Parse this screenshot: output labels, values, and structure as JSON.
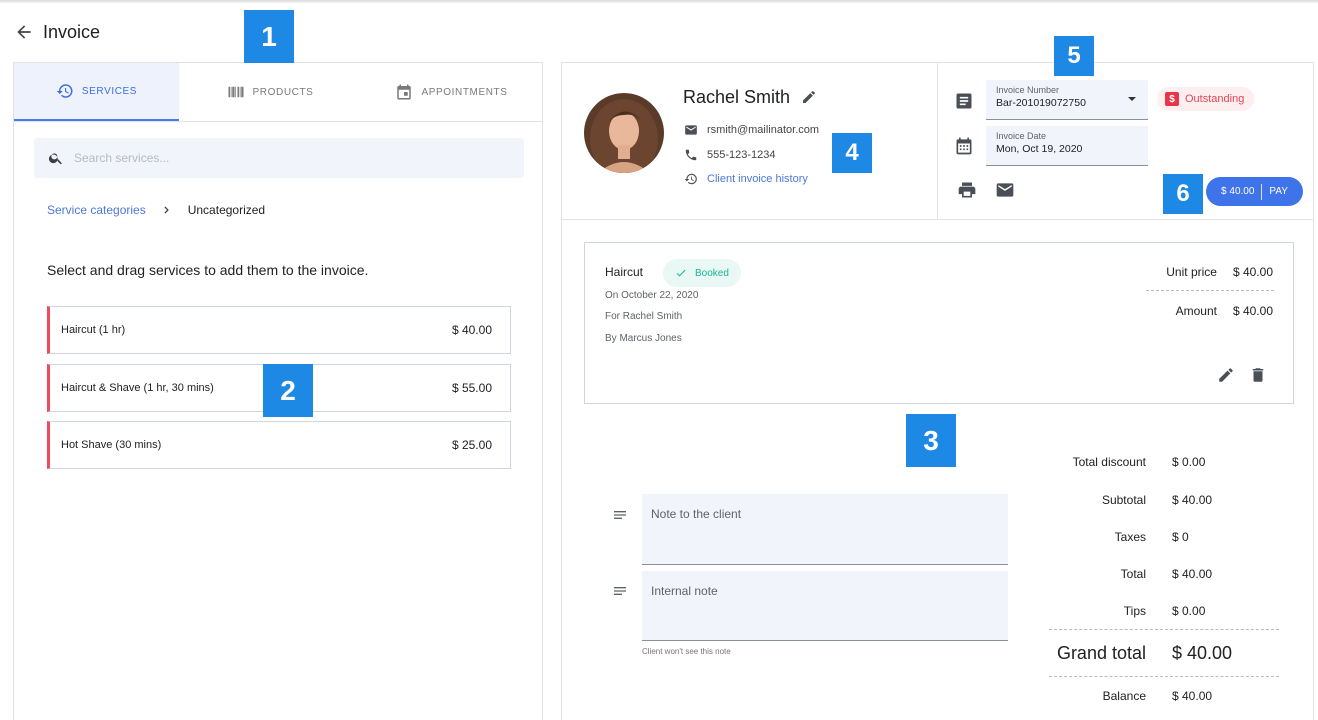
{
  "header": {
    "title": "Invoice"
  },
  "tabs": [
    {
      "label": "SERVICES"
    },
    {
      "label": "PRODUCTS"
    },
    {
      "label": "APPOINTMENTS"
    }
  ],
  "search": {
    "placeholder": "Search services..."
  },
  "breadcrumb": {
    "link": "Service categories",
    "current": "Uncategorized"
  },
  "instructions": "Select and drag services to add them to the invoice.",
  "services": [
    {
      "name": "Haircut (1 hr)",
      "price": "$ 40.00"
    },
    {
      "name": "Haircut & Shave (1 hr, 30 mins)",
      "price": "$ 55.00"
    },
    {
      "name": "Hot Shave (30 mins)",
      "price": "$ 25.00"
    }
  ],
  "client": {
    "name": "Rachel Smith",
    "email": "rsmith@mailinator.com",
    "phone": "555-123-1234",
    "history_link": "Client invoice history"
  },
  "invoice": {
    "number_label": "Invoice Number",
    "number": "Bar-201019072750",
    "date_label": "Invoice Date",
    "date": "Mon, Oct 19, 2020",
    "status": "Outstanding",
    "pay_amount": "$ 40.00",
    "pay_label": "PAY"
  },
  "line_item": {
    "name": "Haircut",
    "status": "Booked",
    "date": "On October 22, 2020",
    "for": "For Rachel Smith",
    "by": "By Marcus Jones",
    "unit_price_label": "Unit price",
    "unit_price": "$ 40.00",
    "amount_label": "Amount",
    "amount": "$ 40.00"
  },
  "notes": {
    "client_placeholder": "Note to the client",
    "internal_placeholder": "Internal note",
    "hint": "Client won't see this note"
  },
  "summary": {
    "total_discount": {
      "label": "Total discount",
      "value": "$ 0.00"
    },
    "subtotal": {
      "label": "Subtotal",
      "value": "$ 40.00"
    },
    "taxes": {
      "label": "Taxes",
      "value": "$ 0"
    },
    "total": {
      "label": "Total",
      "value": "$ 40.00"
    },
    "tips": {
      "label": "Tips",
      "value": "$ 0.00"
    },
    "grand_total": {
      "label": "Grand total",
      "value": "$ 40.00"
    },
    "balance": {
      "label": "Balance",
      "value": "$ 40.00"
    }
  },
  "markers": [
    "1",
    "2",
    "3",
    "4",
    "5",
    "6"
  ],
  "colors": {
    "accent": "#3f73e9",
    "status_outstanding": "#e24655",
    "booked": "#1ab394",
    "service_stripe": "#ee4b5e",
    "marker": "#1e88e5"
  }
}
